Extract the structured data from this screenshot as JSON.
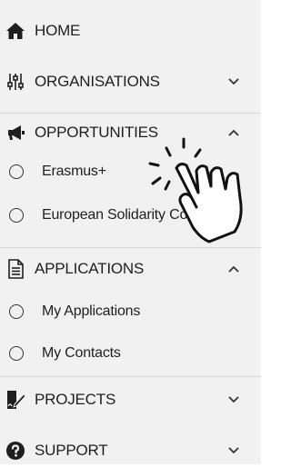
{
  "menu": {
    "home": {
      "label": "HOME",
      "icon": "home-icon"
    },
    "organisations": {
      "label": "ORGANISATIONS",
      "icon": "sliders-icon",
      "state": "collapsed"
    },
    "opportunities": {
      "label": "OPPORTUNITIES",
      "icon": "megaphone-icon",
      "state": "expanded",
      "items": [
        {
          "label": "Erasmus+"
        },
        {
          "label": "European Solidarity Corps"
        }
      ]
    },
    "applications": {
      "label": "APPLICATIONS",
      "icon": "document-icon",
      "state": "expanded",
      "items": [
        {
          "label": "My Applications"
        },
        {
          "label": "My Contacts"
        }
      ]
    },
    "projects": {
      "label": "PROJECTS",
      "icon": "signature-icon",
      "state": "collapsed"
    },
    "support": {
      "label": "SUPPORT",
      "icon": "question-circle-icon",
      "state": "collapsed"
    }
  },
  "overlay": {
    "icon": "tap-hand-icon"
  }
}
